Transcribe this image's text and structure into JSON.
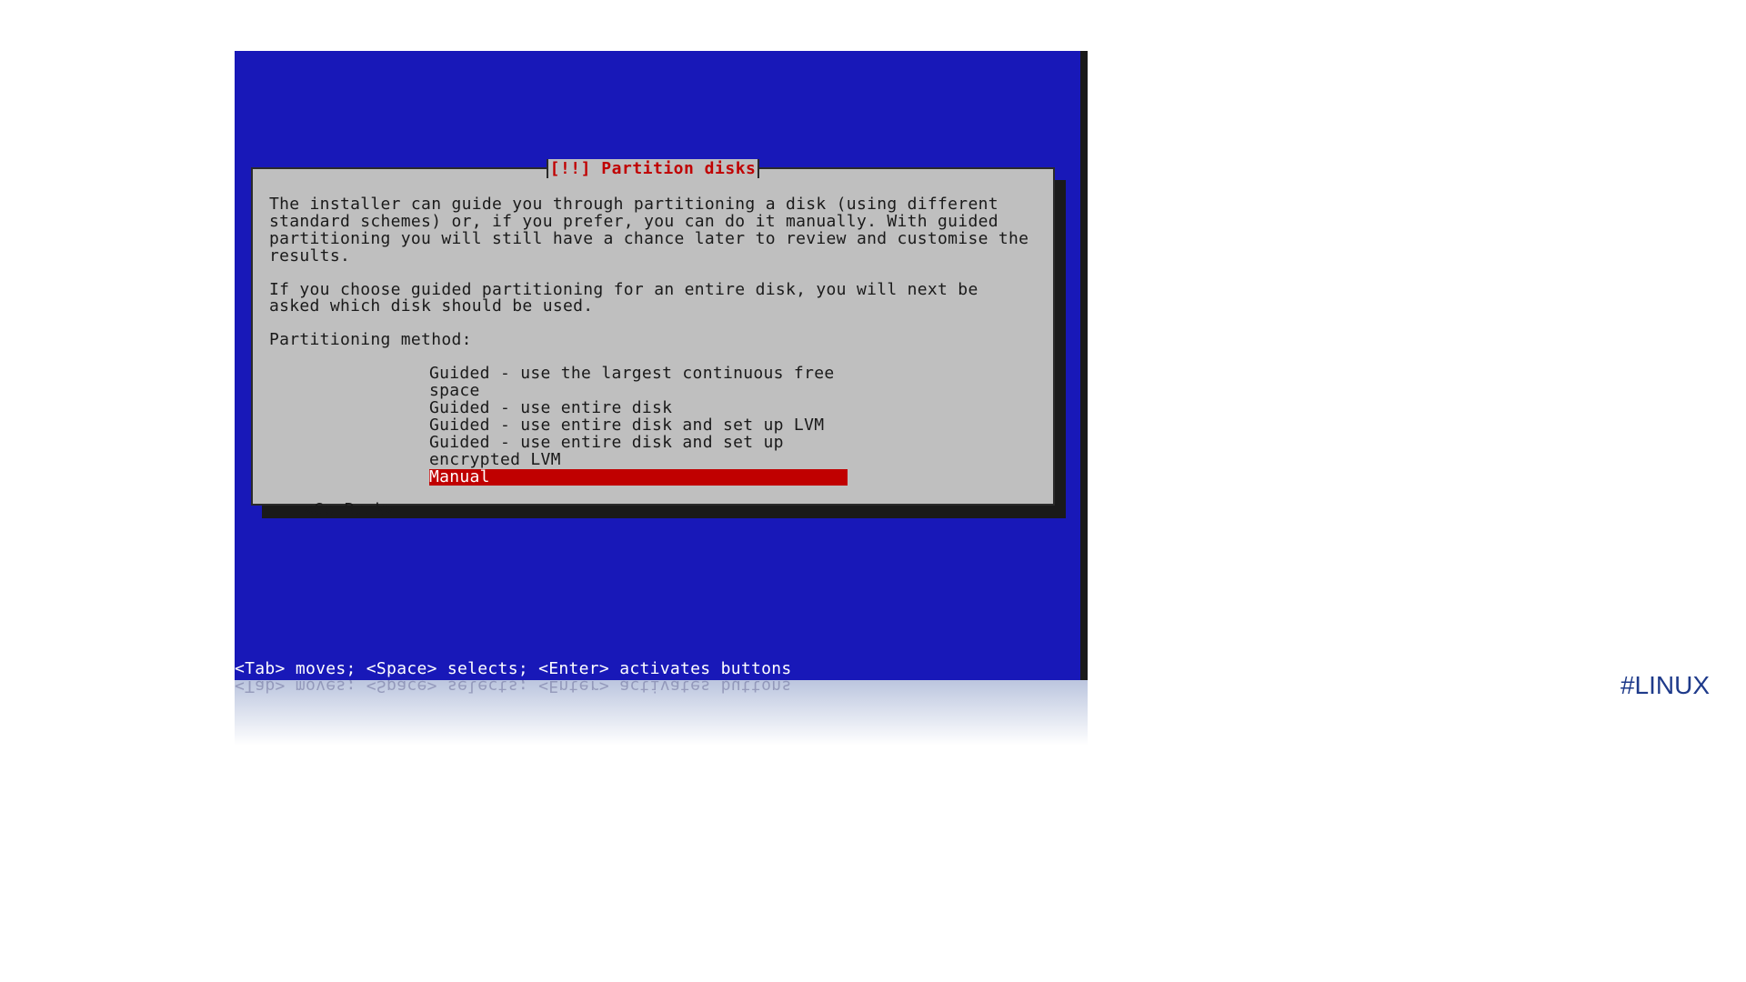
{
  "dialog": {
    "title": "[!!] Partition disks",
    "paragraph1": "The installer can guide you through partitioning a disk (using different standard schemes) or, if you prefer, you can do it manually. With guided partitioning you will still have a chance later to review and customise the results.",
    "paragraph2": "If you choose guided partitioning for an entire disk, you will next be asked which disk should be used.",
    "method_label": "Partitioning method:",
    "options": [
      "Guided - use the largest continuous free space",
      "Guided - use entire disk",
      "Guided - use entire disk and set up LVM",
      "Guided - use entire disk and set up encrypted LVM",
      "Manual"
    ],
    "selected_index": 4,
    "go_back": "<Go Back>"
  },
  "status_bar": "<Tab> moves; <Space> selects; <Enter> activates buttons",
  "hashtag": "#LINUX"
}
